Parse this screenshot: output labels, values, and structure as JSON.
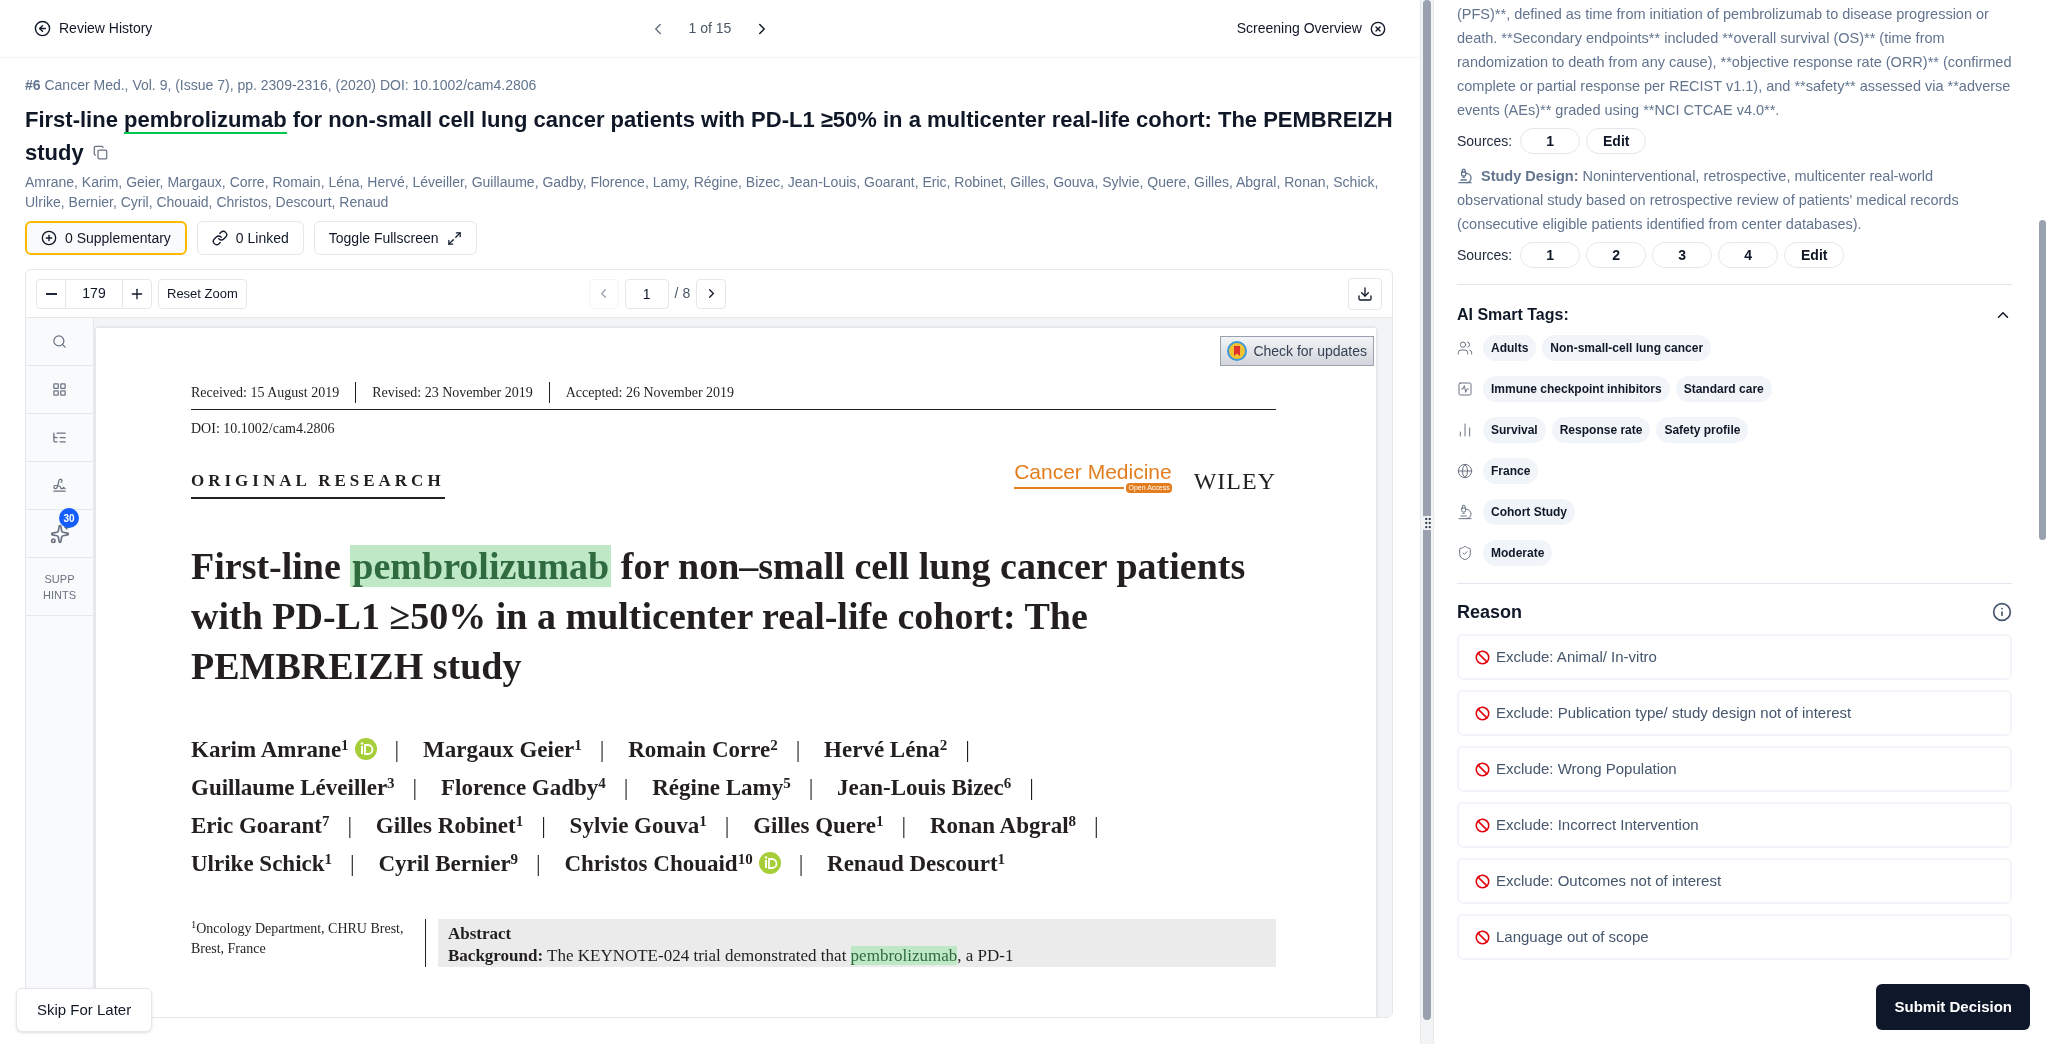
{
  "top_bar": {
    "back": "Review History",
    "pager": "1 of 15",
    "overview": "Screening Overview"
  },
  "article": {
    "number": "#6",
    "citation": "Cancer Med., Vol. 9, (Issue 7), pp. 2309-2316, (2020) DOI: 10.1002/cam4.2806",
    "title": {
      "before": "First-line ",
      "highlight": "pembrolizumab",
      "after": " for non-small cell lung cancer patients with PD-L1 ≥50% in a multicenter real-life cohort: The PEMBREIZH study"
    },
    "authors": "Amrane, Karim, Geier, Margaux, Corre, Romain, Léna, Hervé, Léveiller, Guillaume, Gadby, Florence, Lamy, Régine, Bizec, Jean-Louis, Goarant, Eric, Robinet, Gilles, Gouva, Sylvie, Quere, Gilles, Abgral, Ronan, Schick, Ulrike, Bernier, Cyril, Chouaid, Christos, Descourt, Renaud",
    "actions": [
      {
        "kind": "supplementary",
        "label": "0 Supplementary",
        "selected": true
      },
      {
        "kind": "linked",
        "label": "0 Linked",
        "selected": false
      },
      {
        "kind": "fullscreen",
        "label": "Toggle Fullscreen",
        "selected": false
      }
    ]
  },
  "viewer": {
    "zoom": "179",
    "reset": "Reset Zoom",
    "page": "1",
    "total": "/ 8",
    "rail": [
      {
        "kind": "search"
      },
      {
        "kind": "thumbnails"
      },
      {
        "kind": "outline"
      },
      {
        "kind": "annotate"
      },
      {
        "kind": "hints",
        "badge": "30"
      },
      {
        "kind": "label",
        "label": "SUPP HINTS"
      }
    ],
    "pdf": {
      "check_updates": "Check for updates",
      "dates": [
        "Received: 15 August 2019",
        "Revised: 23 November 2019",
        "Accepted: 26 November 2019"
      ],
      "doi": "DOI: 10.1002/cam4.2806",
      "section": "ORIGINAL RESEARCH",
      "journal": "Cancer Medicine",
      "journal_badge": "Open Access",
      "publisher": "WILEY",
      "title": {
        "before": "First-line ",
        "highlight": "pembrolizumab",
        "after": " for non–small cell lung cancer patients with PD-L1 ≥50% in a multicenter real-life cohort: The PEMBREIZH study"
      },
      "separator": "|",
      "authors": [
        {
          "name": "Karim Amrane",
          "sup": "1",
          "orcid": true
        },
        {
          "name": "Margaux Geier",
          "sup": "1",
          "orcid": false
        },
        {
          "name": "Romain Corre",
          "sup": "2",
          "orcid": false
        },
        {
          "name": "Hervé Léna",
          "sup": "2",
          "orcid": false
        },
        {
          "name": "Guillaume Léveiller",
          "sup": "3",
          "orcid": false
        },
        {
          "name": "Florence Gadby",
          "sup": "4",
          "orcid": false
        },
        {
          "name": "Régine Lamy",
          "sup": "5",
          "orcid": false
        },
        {
          "name": "Jean-Louis Bizec",
          "sup": "6",
          "orcid": false
        },
        {
          "name": "Eric Goarant",
          "sup": "7",
          "orcid": false
        },
        {
          "name": "Gilles Robinet",
          "sup": "1",
          "orcid": false
        },
        {
          "name": "Sylvie Gouva",
          "sup": "1",
          "orcid": false
        },
        {
          "name": "Gilles Quere",
          "sup": "1",
          "orcid": false
        },
        {
          "name": "Ronan Abgral",
          "sup": "8",
          "orcid": false
        },
        {
          "name": "Ulrike Schick",
          "sup": "1",
          "orcid": false
        },
        {
          "name": "Cyril Bernier",
          "sup": "9",
          "orcid": false
        },
        {
          "name": "Christos Chouaid",
          "sup": "10",
          "orcid": true
        },
        {
          "name": "Renaud Descourt",
          "sup": "1",
          "orcid": false
        }
      ],
      "affiliation": {
        "sup": "1",
        "text": "Oncology Department, CHRU Brest, Brest, France"
      },
      "abstract": {
        "heading": "Abstract",
        "label": "Background:",
        "before": " The KEYNOTE-024 trial demonstrated that ",
        "highlight": "pembrolizumab",
        "after": ", a PD-1"
      }
    }
  },
  "skip": "Skip For Later",
  "side": {
    "outcomes_text": "(PFS)**, defined as time from initiation of pembrolizumab to disease progression or death. **Secondary endpoints** included **overall survival (OS)** (time from randomization to death from any cause), **objective response rate (ORR)** (confirmed complete or partial response per RECIST v1.1), and **safety** assessed via **adverse events (AEs)** graded using **NCI CTCAE v4.0**.",
    "outcome_sources": {
      "label": "Sources:",
      "items": [
        "1"
      ],
      "edit": "Edit"
    },
    "design": {
      "label": "Study Design:",
      "text": "Noninterventional, retrospective, multicenter real-world observational study based on retrospective review of patients' medical records (consecutive eligible patients identified from center databases)."
    },
    "design_sources": {
      "label": "Sources:",
      "items": [
        "1",
        "2",
        "3",
        "4"
      ],
      "edit": "Edit"
    },
    "tags": {
      "title": "AI Smart Tags:",
      "expanded": true,
      "groups": [
        {
          "kind": "population",
          "tags": [
            "Adults",
            "Non-small-cell lung cancer"
          ]
        },
        {
          "kind": "intervention",
          "tags": [
            "Immune checkpoint inhibitors",
            "Standard care"
          ]
        },
        {
          "kind": "outcome",
          "tags": [
            "Survival",
            "Response rate",
            "Safety profile"
          ]
        },
        {
          "kind": "location",
          "tags": [
            "France"
          ]
        },
        {
          "kind": "design",
          "tags": [
            "Cohort Study"
          ]
        },
        {
          "kind": "quality",
          "tags": [
            "Moderate"
          ]
        }
      ]
    },
    "reason": {
      "title": "Reason",
      "options": [
        "Exclude: Animal/ In-vitro",
        "Exclude: Publication type/ study design not of interest",
        "Exclude: Wrong Population",
        "Exclude: Incorrect Intervention",
        "Exclude: Outcomes not of interest",
        "Language out of scope"
      ]
    }
  },
  "submit": "Submit Decision"
}
